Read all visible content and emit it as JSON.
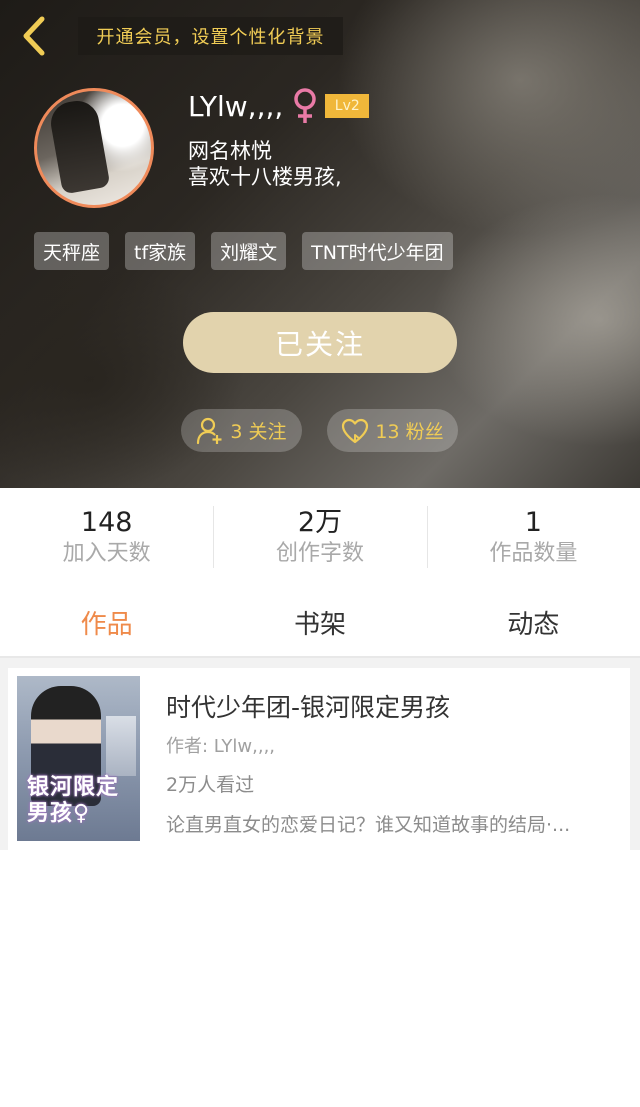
{
  "header": {
    "vip_banner": "开通会员，设置个性化背景",
    "username": "LYlw,,,,",
    "level": "Lv2",
    "bio_line1": "网名林悦",
    "bio_line2": "喜欢十八楼男孩,",
    "tags": [
      "天秤座",
      "tf家族",
      "刘耀文",
      "TNT时代少年团"
    ],
    "follow_button": "已关注",
    "following": "3 关注",
    "fans": "13 粉丝"
  },
  "stats": [
    {
      "value": "148",
      "label": "加入天数"
    },
    {
      "value": "2万",
      "label": "创作字数"
    },
    {
      "value": "1",
      "label": "作品数量"
    }
  ],
  "tabs": [
    {
      "label": "作品",
      "active": true
    },
    {
      "label": "书架",
      "active": false
    },
    {
      "label": "动态",
      "active": false
    }
  ],
  "works": [
    {
      "cover_text_line1": "银河限定",
      "cover_text_line2": "男孩♀",
      "title": "时代少年团-银河限定男孩",
      "author": "作者: LYlw,,,,",
      "views": "2万人看过",
      "description": "论直男直女的恋爱日记？谁又知道故事的结局·..."
    }
  ],
  "colors": {
    "accent": "#ef8a4a",
    "gold": "#f0cc55",
    "follow_button_bg": "#e2d3ad",
    "level_badge": "#f0b73a",
    "avatar_ring": "#ef8a5a"
  },
  "icons": {
    "back": "chevron-left-icon",
    "gender": "female-icon",
    "following": "user-add-icon",
    "fans": "heart-icon"
  }
}
